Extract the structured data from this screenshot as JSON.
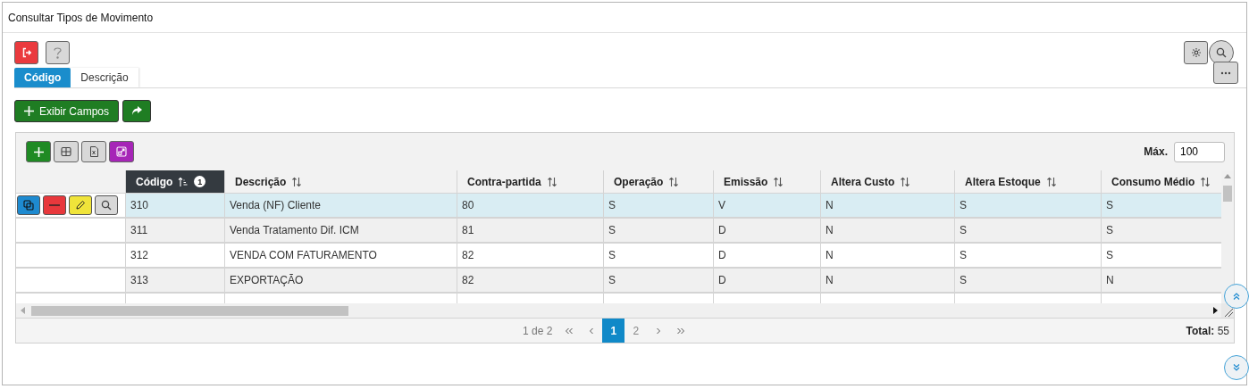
{
  "window": {
    "title": "Consultar Tipos de Movimento"
  },
  "tabs": [
    {
      "label": "Código",
      "selected": true
    },
    {
      "label": "Descrição",
      "selected": false
    }
  ],
  "show_fields_button": "Exibir Campos",
  "grid": {
    "max_label": "Máx.",
    "max_value": "100",
    "columns": [
      {
        "label": "Código",
        "sorted": true,
        "sort_order": "1"
      },
      {
        "label": "Descrição",
        "sorted": false
      },
      {
        "label": "Contra-partida",
        "sorted": false
      },
      {
        "label": "Operação",
        "sorted": false
      },
      {
        "label": "Emissão",
        "sorted": false
      },
      {
        "label": "Altera Custo",
        "sorted": false
      },
      {
        "label": "Altera Estoque",
        "sorted": false
      },
      {
        "label": "Consumo Médio",
        "sorted": false
      }
    ],
    "rows": [
      {
        "selected": true,
        "cells": [
          "310",
          "Venda (NF) Cliente",
          "80",
          "S",
          "V",
          "N",
          "S",
          "S"
        ]
      },
      {
        "selected": false,
        "cells": [
          "311",
          "Venda Tratamento Dif. ICM",
          "81",
          "S",
          "D",
          "N",
          "S",
          "S"
        ]
      },
      {
        "selected": false,
        "cells": [
          "312",
          "VENDA COM FATURAMENTO",
          "82",
          "S",
          "D",
          "N",
          "S",
          "S"
        ]
      },
      {
        "selected": false,
        "cells": [
          "313",
          "EXPORTAÇÃO",
          "82",
          "S",
          "D",
          "N",
          "S",
          "N"
        ]
      }
    ]
  },
  "pager": {
    "summary": "1 de 2",
    "pages": [
      {
        "label": "1",
        "selected": true
      },
      {
        "label": "2",
        "selected": false
      }
    ],
    "total_label": "Total:",
    "total_value": "55"
  }
}
